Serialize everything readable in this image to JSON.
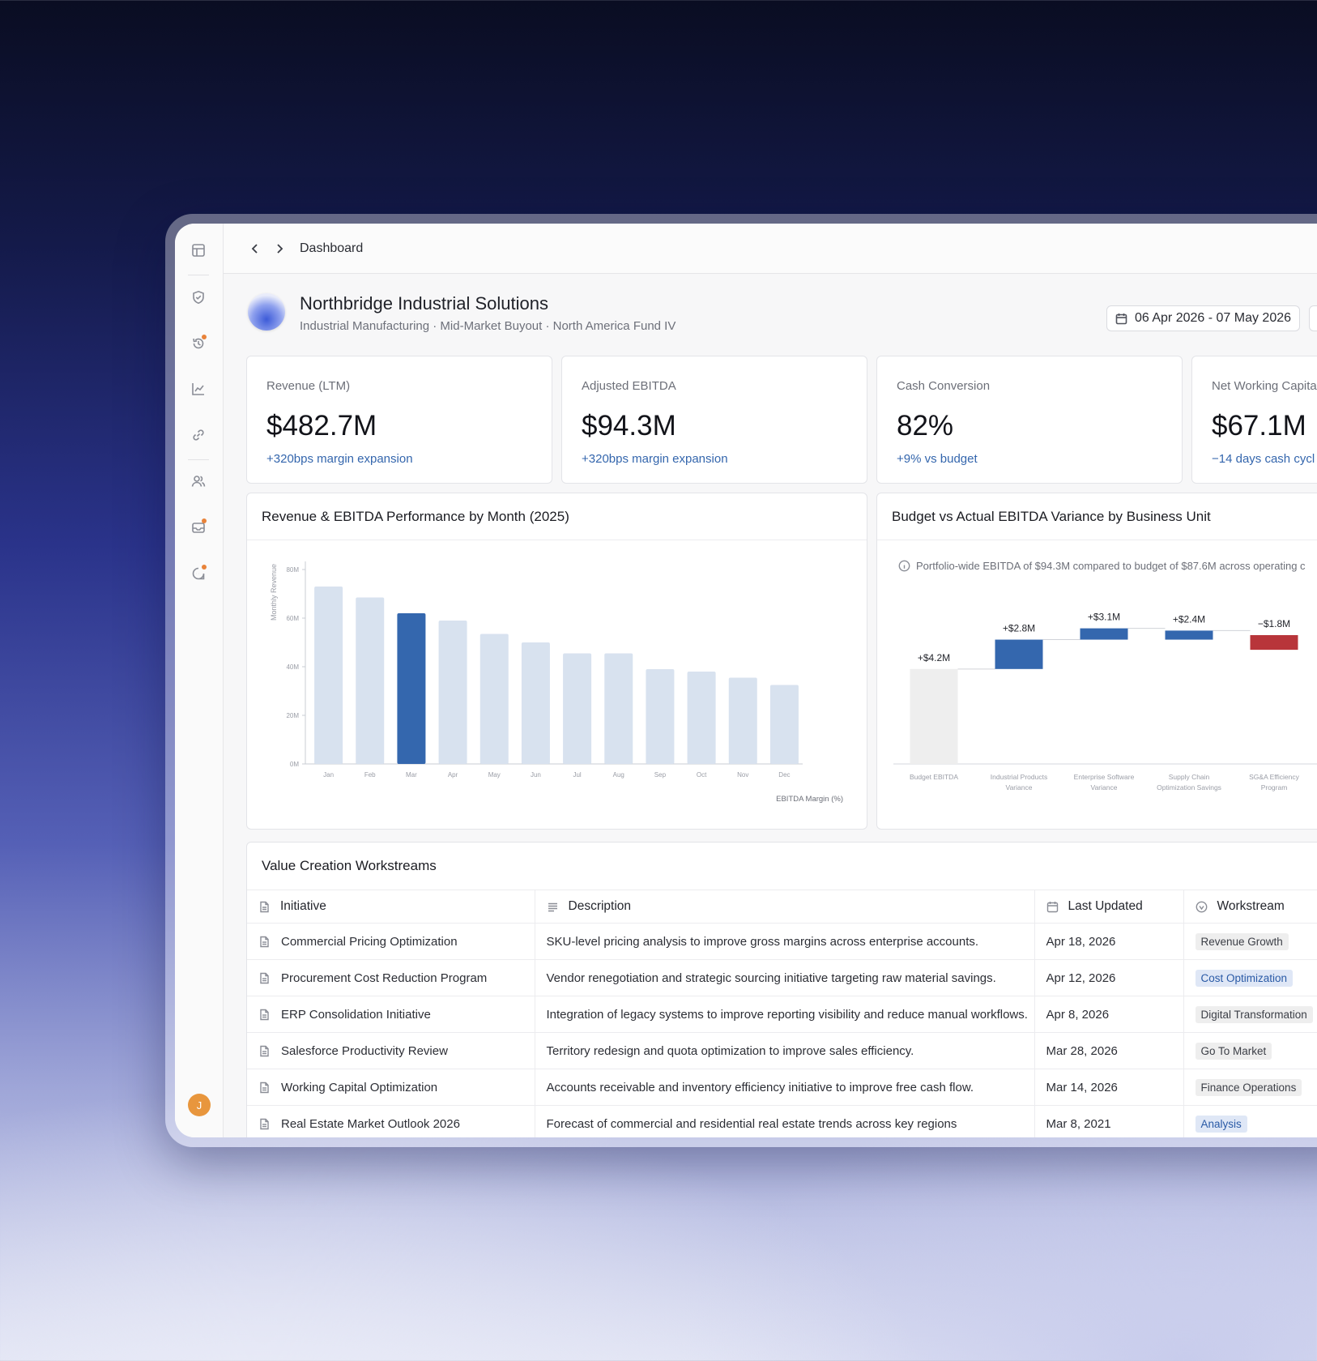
{
  "topbar": {
    "breadcrumb": "Dashboard"
  },
  "company": {
    "name": "Northbridge Industrial Solutions",
    "subtitle": "Industrial Manufacturing · Mid-Market Buyout · North America Fund IV",
    "date_range": "06 Apr 2026 - 07 May 2026"
  },
  "sidebar": {
    "items": [
      "layout-icon",
      "shield-check-icon",
      "history-icon",
      "line-chart-icon",
      "link-icon",
      "users-icon",
      "inbox-icon",
      "chat-icon"
    ],
    "avatar_initial": "J"
  },
  "kpis": [
    {
      "label": "Revenue (LTM)",
      "value": "$482.7M",
      "delta": "+320bps margin expansion"
    },
    {
      "label": "Adjusted EBITDA",
      "value": "$94.3M",
      "delta": "+320bps margin expansion"
    },
    {
      "label": "Cash Conversion",
      "value": "82%",
      "delta": "+9% vs budget"
    },
    {
      "label": "Net Working Capita",
      "value": "$67.1M",
      "delta": "−14 days cash cycl"
    }
  ],
  "revenue_panel": {
    "title": "Revenue & EBITDA Performance by Month (2025)"
  },
  "variance_panel": {
    "title": "Budget vs Actual EBITDA Variance by Business Unit",
    "note": "Portfolio-wide EBITDA of $94.3M compared to budget of $87.6M across operating c"
  },
  "workstreams": {
    "title": "Value Creation Workstreams",
    "columns": [
      "Initiative",
      "Description",
      "Last Updated",
      "Workstream"
    ],
    "rows": [
      {
        "initiative": "Commercial Pricing Optimization",
        "description": "SKU-level pricing analysis to improve gross margins across enterprise accounts.",
        "updated": "Apr 18, 2026",
        "tag": "Revenue Growth"
      },
      {
        "initiative": "Procurement Cost Reduction Program",
        "description": "Vendor renegotiation and strategic sourcing initiative targeting raw material savings.",
        "updated": "Apr 12, 2026",
        "tag": "Cost Optimization"
      },
      {
        "initiative": "ERP Consolidation Initiative",
        "description": "Integration of legacy systems to improve reporting visibility and reduce manual workflows.",
        "updated": "Apr 8, 2026",
        "tag": "Digital Transformation"
      },
      {
        "initiative": "Salesforce Productivity Review",
        "description": "Territory redesign and quota optimization to improve sales efficiency.",
        "updated": "Mar 28, 2026",
        "tag": "Go To Market"
      },
      {
        "initiative": "Working Capital Optimization",
        "description": "Accounts receivable and inventory efficiency initiative to improve free cash flow.",
        "updated": "Mar 14, 2026",
        "tag": "Finance Operations"
      },
      {
        "initiative": "Real Estate Market Outlook 2026",
        "description": "Forecast of commercial and residential real estate trends across key regions",
        "updated": "Mar 8, 2021",
        "tag": "Analysis"
      }
    ],
    "tag_colors": {
      "Revenue Growth": "#eeeeee",
      "Cost Optimization": "#dfe7f6",
      "Digital Transformation": "#eeeeee",
      "Go To Market": "#eeeeee",
      "Finance Operations": "#eeeeee",
      "Analysis": "#dfe7f6"
    },
    "tag_text_colors": {
      "Revenue Growth": "#3c3f47",
      "Cost Optimization": "#2a5aa6",
      "Digital Transformation": "#3c3f47",
      "Go To Market": "#3c3f47",
      "Finance Operations": "#3c3f47",
      "Analysis": "#2a5aa6"
    }
  },
  "chart_data": [
    {
      "type": "bar",
      "title": "Revenue & EBITDA Performance by Month (2025)",
      "categories": [
        "Jan",
        "Feb",
        "Mar",
        "Apr",
        "May",
        "Jun",
        "Jul",
        "Aug",
        "Sep",
        "Oct",
        "Nov",
        "Dec"
      ],
      "values": [
        73,
        68.5,
        62,
        59,
        53.5,
        50,
        45.5,
        45.5,
        39,
        38,
        35.5,
        32.5
      ],
      "highlight_index": 2,
      "ylabel": "Monthly Revenue",
      "xlabel": "EBITDA Margin (%)",
      "yticks": [
        "0M",
        "20M",
        "40M",
        "60M",
        "80M"
      ],
      "ylim": [
        0,
        80
      ],
      "colors": {
        "bar": "#d8e2ef",
        "highlight": "#3467ae",
        "axis": "#c9ccd3",
        "tick": "#9a9da6"
      }
    },
    {
      "type": "bar",
      "subtype": "waterfall",
      "title": "Budget vs Actual EBITDA Variance by Business Unit",
      "categories": [
        "Budget EBITDA",
        "Industrial Products Variance",
        "Enterprise Software Variance",
        "Supply Chain Optimization Savings",
        "SG&A Efficiency Program"
      ],
      "category_lines": [
        [
          "Budget EBITDA"
        ],
        [
          "Industrial Products",
          "Variance"
        ],
        [
          "Enterprise Software",
          "Variance"
        ],
        [
          "Supply Chain",
          "Optimization Savings"
        ],
        [
          "SG&A Efficiency",
          "Program"
        ]
      ],
      "labels": [
        "+$4.2M",
        "+$2.8M",
        "+$3.1M",
        "+$2.4M",
        "−$1.8M"
      ],
      "bars": [
        {
          "start": 0,
          "end": 4.2,
          "kind": "base"
        },
        {
          "start": 4.2,
          "end": 5.5,
          "kind": "increase"
        },
        {
          "start": 5.5,
          "end": 6.0,
          "kind": "increase"
        },
        {
          "start": 5.5,
          "end": 5.9,
          "kind": "increase"
        },
        {
          "start": 5.7,
          "end": 5.05,
          "kind": "decrease"
        }
      ],
      "ylim": [
        0,
        7
      ],
      "colors": {
        "base": "#eeeeee",
        "increase": "#3467ae",
        "decrease": "#b8353a",
        "axis": "#d5d7dc",
        "tick": "#9a9da6"
      }
    }
  ]
}
